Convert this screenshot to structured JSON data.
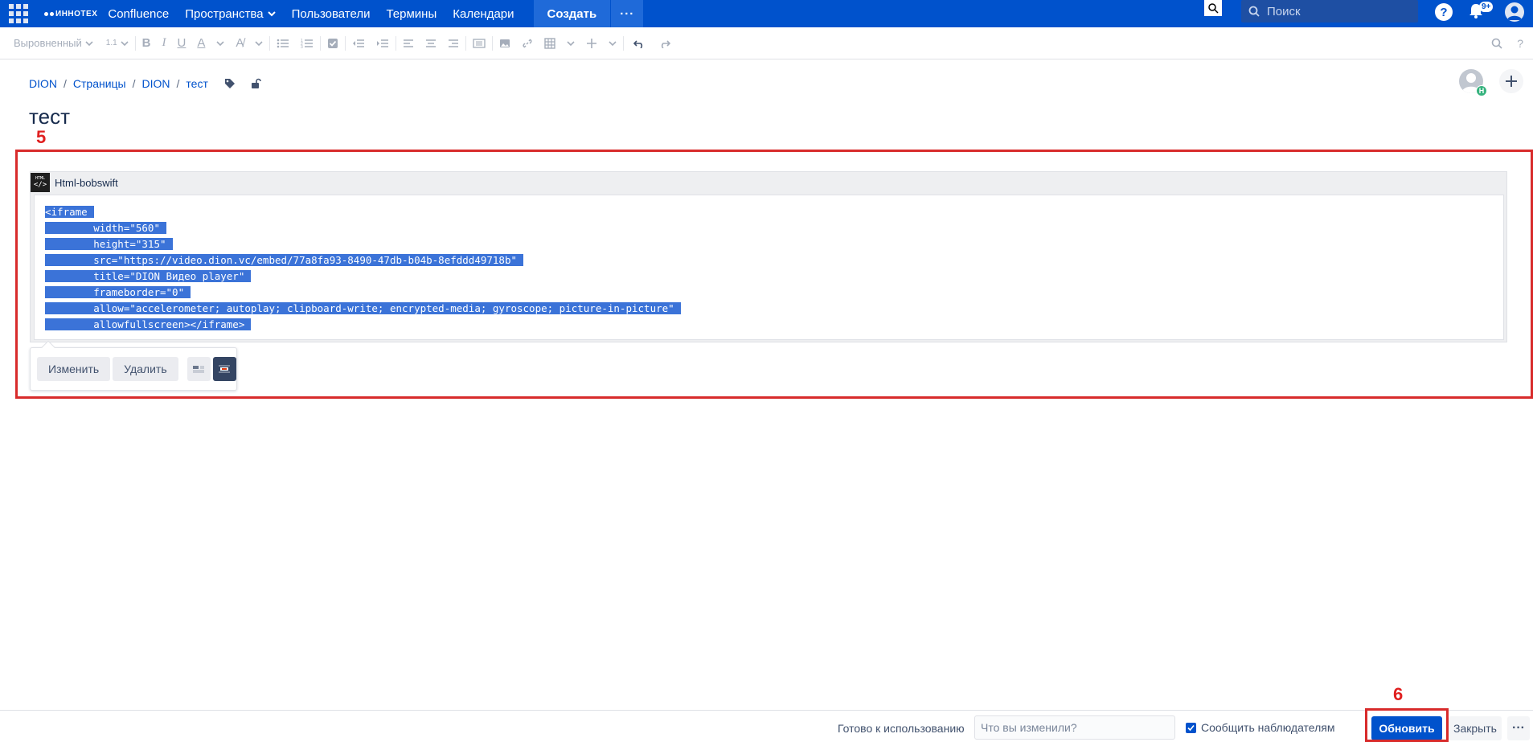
{
  "nav": {
    "brand": "ИННОТЕХ",
    "items": [
      {
        "label": "Confluence"
      },
      {
        "label": "Пространства"
      },
      {
        "label": "Пользователи"
      },
      {
        "label": "Термины"
      },
      {
        "label": "Календари"
      }
    ],
    "create_label": "Создать",
    "more_label": "···",
    "search_placeholder": "Поиск",
    "help_label": "?",
    "notifications_badge": "9+"
  },
  "toolbar": {
    "paragraph_style": "Выровненный",
    "line_spacing": "1.1"
  },
  "breadcrumb": [
    "DION",
    "Страницы",
    "DION",
    "тест"
  ],
  "breadcrumb_sep": "/",
  "page": {
    "title": "тест",
    "avatar_badge": "Н"
  },
  "annotations": {
    "box1_number": "5",
    "box2_number": "6",
    "color": "#d82b2b"
  },
  "macro": {
    "name": "Html-bobswift",
    "icon_text_top": "HTML",
    "icon_text_mid": "</>",
    "code_lines": [
      "<iframe",
      "        width=\"560\"",
      "        height=\"315\"",
      "        src=\"https://video.dion.vc/embed/77a8fa93-8490-47db-b04b-8efddd49718b\"",
      "        title=\"DION Видео player\"",
      "        frameborder=\"0\"",
      "        allow=\"accelerometer; autoplay; clipboard-write; encrypted-media; gyroscope; picture-in-picture\"",
      "        allowfullscreen></iframe>"
    ],
    "edit_label": "Изменить",
    "delete_label": "Удалить"
  },
  "footer": {
    "status": "Готово к использованию",
    "comment_placeholder": "Что вы изменили?",
    "notify_label": "Сообщить наблюдателям",
    "notify_checked": true,
    "update_label": "Обновить",
    "close_label": "Закрыть",
    "more_label": "···"
  },
  "colors": {
    "nav_bg": "#0052cc",
    "primary": "#0052cc",
    "selection": "#3b73d8"
  }
}
